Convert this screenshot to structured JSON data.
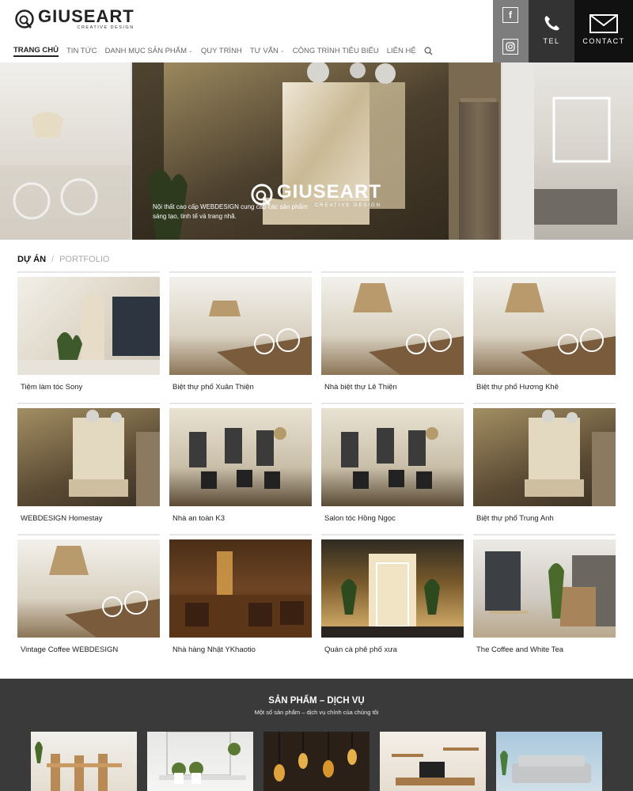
{
  "brand": {
    "name": "GIUSEART",
    "tagline": "CREATIVE DESIGN"
  },
  "nav": {
    "items": [
      {
        "label": "TRANG CHỦ",
        "active": true,
        "dropdown": false
      },
      {
        "label": "TIN TỨC",
        "active": false,
        "dropdown": false
      },
      {
        "label": "DANH MỤC SẢN PHẨM",
        "active": false,
        "dropdown": true
      },
      {
        "label": "QUY TRÌNH",
        "active": false,
        "dropdown": false
      },
      {
        "label": "TƯ VẤN",
        "active": false,
        "dropdown": true
      },
      {
        "label": "CÔNG TRÌNH TIÊU BIỂU",
        "active": false,
        "dropdown": false
      },
      {
        "label": "LIÊN HỆ",
        "active": false,
        "dropdown": false
      }
    ],
    "search_icon": "search-icon"
  },
  "social": {
    "facebook": "f",
    "instagram_icon": "instagram-icon"
  },
  "header_buttons": {
    "tel_label": "TEL",
    "contact_label": "CONTACT"
  },
  "hero": {
    "logo_name": "GIUSEART",
    "logo_tagline": "CREATIVE DESIGN",
    "caption": "Nội thất cao cấp WEBDESIGN cung cấp các sản phẩm sáng tạo, tinh tế và trang nhã."
  },
  "projects": {
    "heading_active": "DỰ ÁN",
    "separator": "/",
    "heading_muted": "PORTFOLIO",
    "items": [
      {
        "title": "Tiệm làm tóc Sony"
      },
      {
        "title": "Biệt thự phố Xuân Thiện"
      },
      {
        "title": "Nhà biệt thự Lê Thiện"
      },
      {
        "title": "Biệt thự phố Hương Khê"
      },
      {
        "title": "WEBDESIGN Homestay"
      },
      {
        "title": "Nhà an toàn K3"
      },
      {
        "title": "Salon tóc Hồng Ngọc"
      },
      {
        "title": "Biệt thự phố Trung Anh"
      },
      {
        "title": "Vintage Coffee WEBDESIGN"
      },
      {
        "title": "Nhà hàng Nhật YKhaotio"
      },
      {
        "title": "Quán cà phê phố xưa"
      },
      {
        "title": "The Coffee and White Tea"
      }
    ]
  },
  "services": {
    "title": "SẢN PHẨM – DỊCH VỤ",
    "subtitle": "Một số sản phẩm – dịch vụ chính của chúng tôi"
  },
  "colors": {
    "accent_dark": "#111111",
    "social_gray": "#7d7d7d",
    "services_bg": "#3a3a3a"
  }
}
